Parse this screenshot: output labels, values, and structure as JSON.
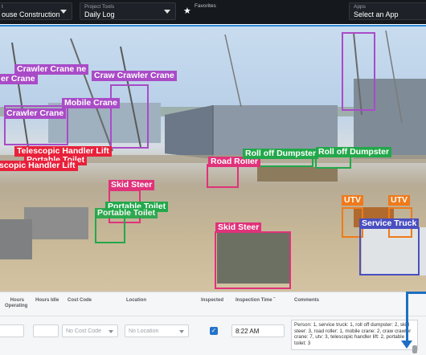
{
  "topbar": {
    "project": {
      "label": "t",
      "value": "ouse Construction"
    },
    "tools": {
      "label": "Project Tools",
      "value": "Daily Log"
    },
    "favorites": {
      "label": "Favorites"
    },
    "apps": {
      "label": "Apps",
      "value": "Select an App"
    }
  },
  "detections": [
    {
      "label": "Crawler Crane",
      "color": "#a94bc7"
    },
    {
      "label": "ne",
      "color": "#a94bc7"
    },
    {
      "label": "er Crane",
      "color": "#a94bc7"
    },
    {
      "label": "Craw Crawler Crane",
      "color": "#a94bc7"
    },
    {
      "label": "Mobile Crane",
      "color": "#a94bc7"
    },
    {
      "label": "Crawler Crane",
      "color": "#a94bc7"
    },
    {
      "label": "Telescopic Handler Lift",
      "color": "#e8213a"
    },
    {
      "label": "Portable Toilet",
      "color": "#e8213a"
    },
    {
      "label": "scopic Handler Lift",
      "color": "#e8213a"
    },
    {
      "label": "Road Roller",
      "color": "#e0327a"
    },
    {
      "label": "Roll off Dumpster",
      "color": "#22a84a"
    },
    {
      "label": "Roll off Dumpster",
      "color": "#22a84a"
    },
    {
      "label": "Skid Steer",
      "color": "#e0327a"
    },
    {
      "label": "Portable Toilet",
      "color": "#22a84a"
    },
    {
      "label": "Portable Toilet",
      "color": "#22a84a"
    },
    {
      "label": "Skid Steer",
      "color": "#e0327a"
    },
    {
      "label": "UTV",
      "color": "#f07a1a"
    },
    {
      "label": "UTV",
      "color": "#f07a1a"
    },
    {
      "label": "Service Truck",
      "color": "#4a4fc0"
    }
  ],
  "table": {
    "headers": {
      "hours_operating": "Hours Operating",
      "hours_idle": "Hours Idle",
      "cost_code": "Cost Code",
      "location": "Location",
      "inspected": "Inspected",
      "inspection_time": "Inspection Time",
      "inspection_time_sort": "ˇ",
      "comments": "Comments"
    },
    "row": {
      "cost_code_placeholder": "No Cost Code",
      "location_placeholder": "No Location",
      "inspected_mark": "✓",
      "inspection_time": "8:22 AM",
      "comments": "Person: 1, service truck: 1, roll off dumpster: 2, skid steer: 3, road roller: 1, mobile crane: 2, craw crawler crane: 7, utv: 3, telescopic handler lift: 2, portable toilet: 3"
    }
  },
  "colors": {
    "topbar_bg": "#15181c",
    "accent": "#2a8bd8",
    "annotation_arrow": "#1e6fc3"
  }
}
